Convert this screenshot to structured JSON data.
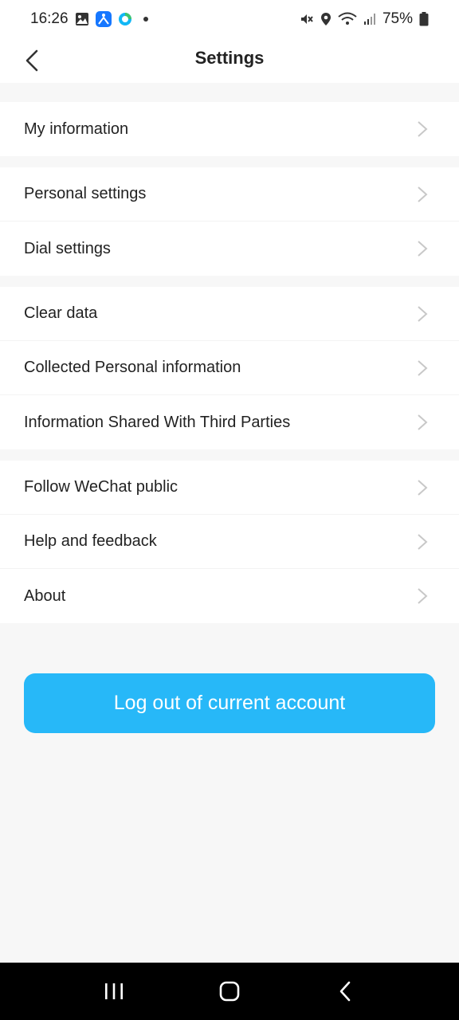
{
  "status_bar": {
    "time": "16:26",
    "battery": "75%",
    "icons": [
      "gallery-icon",
      "app-notification-icon",
      "app-notification-icon-2",
      "dot-icon",
      "mute-icon",
      "location-icon",
      "wifi-icon",
      "signal-icon",
      "battery-icon"
    ]
  },
  "header": {
    "title": "Settings",
    "back_icon": "chevron-left-icon"
  },
  "groups": [
    {
      "items": [
        {
          "label": "My information"
        }
      ]
    },
    {
      "items": [
        {
          "label": "Personal settings"
        },
        {
          "label": "Dial settings"
        }
      ]
    },
    {
      "items": [
        {
          "label": "Clear data"
        },
        {
          "label": "Collected Personal information"
        },
        {
          "label": "Information Shared With Third Parties"
        }
      ]
    },
    {
      "items": [
        {
          "label": "Follow WeChat public"
        },
        {
          "label": "Help and feedback"
        },
        {
          "label": "About"
        }
      ]
    }
  ],
  "logout": {
    "label": "Log out of current account"
  },
  "colors": {
    "accent": "#27b8f8",
    "background": "#f7f7f7",
    "chevron": "#c8c8c8"
  },
  "nav_bar": {
    "icons": [
      "recent-apps-icon",
      "home-icon",
      "back-icon"
    ]
  }
}
